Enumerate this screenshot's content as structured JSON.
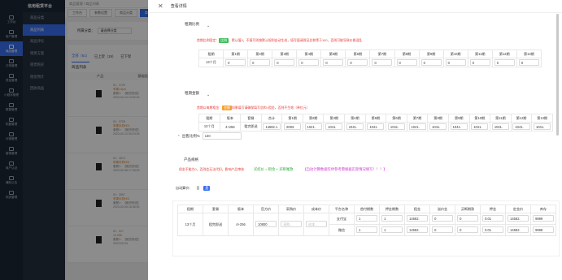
{
  "app": {
    "title": "信用租赁平台",
    "brand_color": "#3a6ff0"
  },
  "sidebar": {
    "items": [
      {
        "label": "工作台",
        "icon": "home-icon"
      },
      {
        "label": "用户管理",
        "icon": "user-icon"
      },
      {
        "label": "商品管理",
        "icon": "goods-icon",
        "active": true
      },
      {
        "label": "订单管理",
        "icon": "order-icon"
      },
      {
        "label": "资金管理",
        "icon": "money-icon"
      },
      {
        "label": "小程序管理",
        "icon": "miniapp-icon"
      },
      {
        "label": "数据管理",
        "icon": "data-icon"
      },
      {
        "label": "机器管理",
        "icon": "machine-icon"
      },
      {
        "label": "分销管理",
        "icon": "share-icon"
      },
      {
        "label": "营销管理",
        "icon": "market-icon"
      },
      {
        "label": "商户认证",
        "icon": "merchant-icon"
      },
      {
        "label": "通知公告",
        "icon": "notice-icon"
      },
      {
        "label": "系统管理",
        "icon": "system-icon"
      }
    ]
  },
  "submenu": {
    "items": [
      {
        "label": "商品分类"
      },
      {
        "label": "商品列表",
        "active": true
      },
      {
        "label": "商品评论"
      },
      {
        "label": "租赁方案"
      },
      {
        "label": "租赁购买"
      },
      {
        "label": "租金预计"
      },
      {
        "label": "回收商品"
      }
    ]
  },
  "background": {
    "breadcrumb": "商品管理  /  商品列表",
    "tabs": [
      {
        "label": "工作台"
      },
      {
        "label": "参数设置"
      },
      {
        "label": "商品分类"
      },
      {
        "label": "商品列表",
        "active": true
      }
    ],
    "filter_label": "所属分类：",
    "filter_value": "请选择分类",
    "status_tabs": [
      {
        "label": "全部（61）",
        "active": true
      },
      {
        "label": "已上架（19）"
      },
      {
        "label": "已下架"
      }
    ],
    "list_title": "商品列表",
    "columns": [
      "产品",
      "基础信息"
    ],
    "products": [
      {
        "id": "ID：3729",
        "name": "苹果14pro",
        "sub": "套餐1：【租完即送】",
        "date": "2023-02-10 10:02:43"
      },
      {
        "id": "ID：3728",
        "name": "苹果手机H01",
        "sub": "套餐1：【租完即送】",
        "date": "2023-02-10 09:23:25"
      },
      {
        "id": "ID：3674",
        "name": "苹果手机H01",
        "sub": "套餐1：【租完即送】",
        "date": "2023-02-08 17:35:30"
      },
      {
        "id": "ID：3597",
        "name": "苹果手机H01",
        "sub": "套餐1：【租完即送】",
        "date": "2023-02-06 16:35:30"
      },
      {
        "id": "ID：917",
        "name": "13 256",
        "sub": "套餐1：【租完即送】",
        "date": "2023-02-04"
      }
    ]
  },
  "drawer": {
    "title": "查看详情",
    "close_icon": "close-icon",
    "rent_ratio": {
      "label": "租期比例",
      "tip_prefix": "首期比例固定：",
      "tip_tag": "比例",
      "tip_rest": "，默认值0，不填写则按默认规则自动生成，填写值请保证总和等于100，否则可能导致价格混乱",
      "headers": [
        "租期",
        "第1期",
        "第2期",
        "第3期",
        "第4期",
        "第5期",
        "第6期",
        "第7期",
        "第8期",
        "第9期",
        "第10期",
        "第11期",
        "第12期",
        "第13期"
      ],
      "row": {
        "term": "13个月",
        "values": [
          "0",
          "0",
          "0",
          "0",
          "0",
          "0",
          "0",
          "0",
          "0",
          "0",
          "0",
          "0",
          "0"
        ]
      }
    },
    "rent_amount": {
      "label": "租期金额",
      "tip_prefix": "首期以每期租金：",
      "tip_tag": "金额",
      "tip_rest": "如果填写请确保填写总和=租金，否则不生效（单位元）",
      "headers": [
        "租期",
        "版本",
        "套餐",
        "合计",
        "第1期",
        "第2期",
        "第3期",
        "第4期",
        "第5期",
        "第6期",
        "第7期",
        "第8期",
        "第9期",
        "第10期",
        "第11期",
        "第12期",
        "第13期"
      ],
      "row": {
        "term": "13个月",
        "version": "4+256",
        "plan": "租完即送",
        "total": "14582.1",
        "values": [
          "2083.",
          "1041.",
          "1041.",
          "1041.",
          "1041.",
          "1041.",
          "1041.",
          "1041.",
          "1041.",
          "1041.",
          "1041.",
          "1041.",
          "1041."
        ]
      }
    },
    "sell_ratio": {
      "label": "出售比例%",
      "required": "*",
      "value": "130"
    },
    "product_spec": {
      "label": "产品规格",
      "tip": "保金不能为0，否则会无法代扣，影响产品审核",
      "formula": "买结价 = 租金 + 买断尾款",
      "warning": "【自动计算数据仅供参考需根据实际情况填写！！！】"
    },
    "sku": {
      "auto_label": "自动算价：",
      "opt_no": "否",
      "opt_yes": "是",
      "headers": [
        "租期",
        "套餐",
        "版本",
        "官方价",
        "采购价",
        "成本价",
        "平台名称",
        "首付期数",
        "押金期数",
        "租金",
        "溢价金",
        "买断期款",
        "押金",
        "定金价",
        "库存"
      ],
      "row": {
        "term": "13个月",
        "plan": "租完即送",
        "version": "4+256",
        "official": "10800",
        "purchase_ph": "采购...",
        "cost_ph": "成本...",
        "platforms": [
          {
            "name": "支付宝",
            "first": "1",
            "deposit_terms": "1",
            "rent": "14582.",
            "premium": "0",
            "buyout": "0",
            "deposit": "0.01",
            "price": "14582.",
            "stock": "9999"
          },
          {
            "name": "微信",
            "first": "1",
            "deposit_terms": "1",
            "rent": "14582.",
            "premium": "0",
            "buyout": "0",
            "deposit": "0.01",
            "price": "14582.",
            "stock": "9999"
          }
        ]
      }
    }
  }
}
